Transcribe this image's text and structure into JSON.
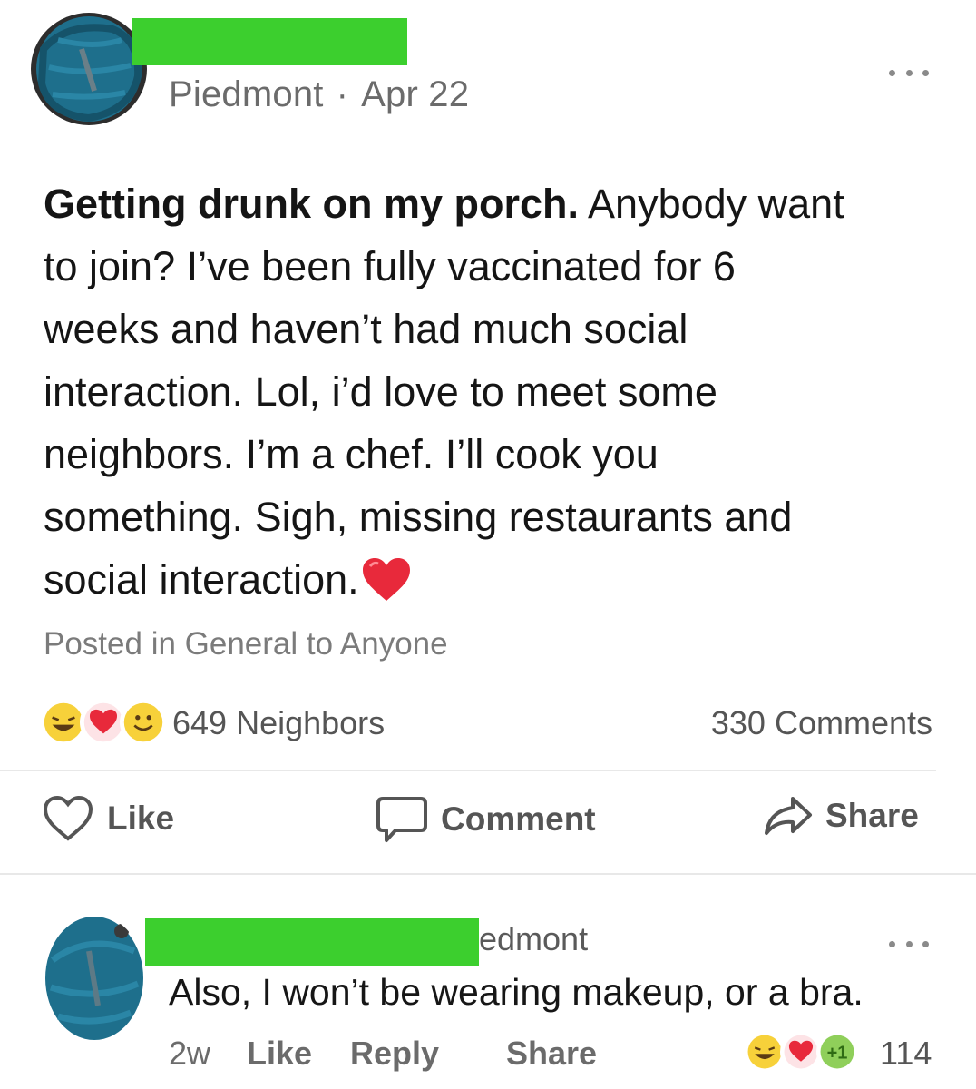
{
  "post": {
    "location": "Piedmont",
    "separator": "·",
    "date": "Apr 22",
    "body_bold": "Getting drunk on my porch.",
    "body_line1_rest": " Anybody want",
    "body_line2": "to join? I’ve been fully vaccinated for 6",
    "body_line3": "weeks and haven’t had much social",
    "body_line4": "interaction. Lol, i’d love to meet some",
    "body_line5": "neighbors. I’m a chef. I’ll cook you",
    "body_line6": "something. Sigh, missing restaurants and",
    "body_line7": "social interaction.",
    "posted_in": "Posted in General to Anyone",
    "reactions_label": "649 Neighbors",
    "comments_label": "330 Comments",
    "reaction_icons": [
      "laughing-emoji",
      "heart-emoji",
      "smile-emoji"
    ]
  },
  "actions": {
    "like": "Like",
    "comment": "Comment",
    "share": "Share"
  },
  "comment": {
    "name_tail": "edmont",
    "text": "Also, I won’t be wearing makeup, or a bra.",
    "time": "2w",
    "like": "Like",
    "reply": "Reply",
    "share": "Share",
    "reaction_extra": "+1",
    "reaction_count": "114",
    "reaction_icons": [
      "laughing-emoji",
      "heart-emoji"
    ]
  },
  "colors": {
    "redaction": "#3ccf2e",
    "avatar_scribble": "#1e6f8c",
    "heart": "#e8293b",
    "emoji_yellow": "#f7d13a",
    "plus_one_green": "#8fcf5a"
  }
}
